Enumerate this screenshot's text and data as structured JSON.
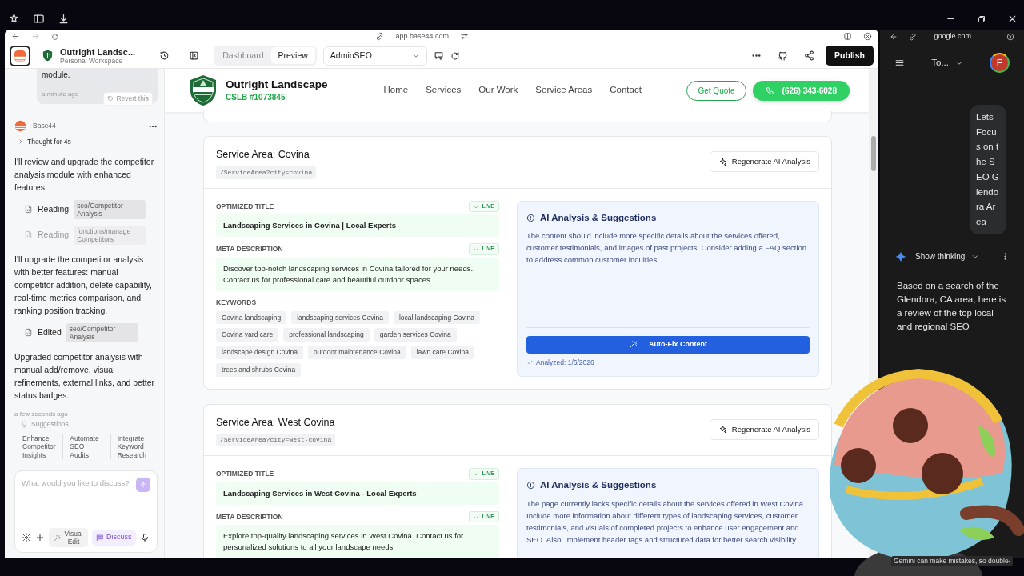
{
  "browser": {
    "url": "app.base44.com"
  },
  "toolbar": {
    "project_name": "Outright Landsc...",
    "workspace": "Personal Workspace",
    "tabs": [
      {
        "label": "Dashboard",
        "selected": false
      },
      {
        "label": "Preview",
        "selected": true
      }
    ],
    "page_select": "AdminSEO",
    "publish": "Publish"
  },
  "chat": {
    "previous_message_tail": "module.",
    "previous_time": "a minute ago",
    "revert": "Revert this",
    "sender": "Base44",
    "thought": "Thought for 4s",
    "steps": [
      {
        "kind": "text",
        "text": "I'll review and upgrade the competitor analysis module with enhanced features."
      },
      {
        "kind": "file",
        "action": "Reading",
        "path": "seo/Competitor Analysis",
        "disabled": false
      },
      {
        "kind": "file",
        "action": "Reading",
        "path": "functions/manage Competitors",
        "disabled": true
      },
      {
        "kind": "text",
        "text": "I'll upgrade the competitor analysis with better features: manual competitor addition, delete capability, real-time metrics comparison, and ranking position tracking."
      },
      {
        "kind": "file",
        "action": "Edited",
        "path": "seo/Competitor Analysis",
        "disabled": false
      },
      {
        "kind": "text",
        "text": "Upgraded competitor analysis with manual add/remove, visual refinements, external links, and better status badges."
      }
    ],
    "time": "a few seconds ago",
    "suggestions_label": "Suggestions",
    "suggestions": [
      "Enhance Competitor Insights",
      "Automate SEO Audits",
      "Integrate Keyword Research"
    ],
    "input_placeholder": "What would you like to discuss?",
    "visual_edit": "Visual Edit",
    "discuss": "Discuss"
  },
  "site_header": {
    "name": "Outright Landscape",
    "license": "CSLB #1073845",
    "nav": [
      "Home",
      "Services",
      "Our Work",
      "Service Areas",
      "Contact"
    ],
    "quote": "Get Quote",
    "phone": "(626) 343-6028"
  },
  "service_areas": [
    {
      "title": "Service Area: Covina",
      "path": "/ServiceArea?city=covina",
      "regenerate": "Regenerate AI Analysis",
      "fields": [
        {
          "label": "OPTIMIZED TITLE",
          "status": "LIVE",
          "value": "Landscaping Services in Covina | Local Experts",
          "kind": "title"
        },
        {
          "label": "META DESCRIPTION",
          "status": "LIVE",
          "value": "Discover top-notch landscaping services in Covina tailored for your needs. Contact us for professional care and beautiful outdoor spaces.",
          "kind": "description"
        }
      ],
      "keywords_label": "KEYWORDS",
      "keywords": [
        "Covina landscaping",
        "landscaping services Covina",
        "local landscaping Covina",
        "Covina yard care",
        "professional landscaping",
        "garden services Covina",
        "landscape design Covina",
        "outdoor maintenance Covina",
        "lawn care Covina",
        "trees and shrubs Covina"
      ],
      "analysis": {
        "title": "AI Analysis & Suggestions",
        "text": "The content should include more specific details about the services offered, customer testimonials, and images of past projects. Consider adding a FAQ section to address common customer inquiries.",
        "button": "Auto-Fix Content",
        "analyzed": "Analyzed: 1/6/2026"
      }
    },
    {
      "title": "Service Area: West Covina",
      "path": "/ServiceArea?city=west-covina",
      "regenerate": "Regenerate AI Analysis",
      "fields": [
        {
          "label": "OPTIMIZED TITLE",
          "status": "LIVE",
          "value": "Landscaping Services in West Covina - Local Experts",
          "kind": "title"
        },
        {
          "label": "META DESCRIPTION",
          "status": "LIVE",
          "value": "Explore top-quality landscaping services in West Covina. Contact us for personalized solutions to all your landscape needs!",
          "kind": "description"
        }
      ],
      "analysis": {
        "title": "AI Analysis & Suggestions",
        "text": "The page currently lacks specific details about the services offered in West Covina. Include more information about different types of landscaping services, customer testimonials, and visuals of completed projects to enhance user engagement and SEO. Also, implement header tags and structured data for better search visibility."
      }
    }
  ],
  "gemini": {
    "url": "...google.com",
    "title": "To...",
    "avatar": "F",
    "user_message": "Lets Focus on the SEO Glendora Area",
    "show_thinking": "Show thinking",
    "response": "Based on a search of the Glendora, CA area, here is a review of the top local and regional SEO",
    "disclaimer": "Gemini can make mistakes, so double-"
  }
}
